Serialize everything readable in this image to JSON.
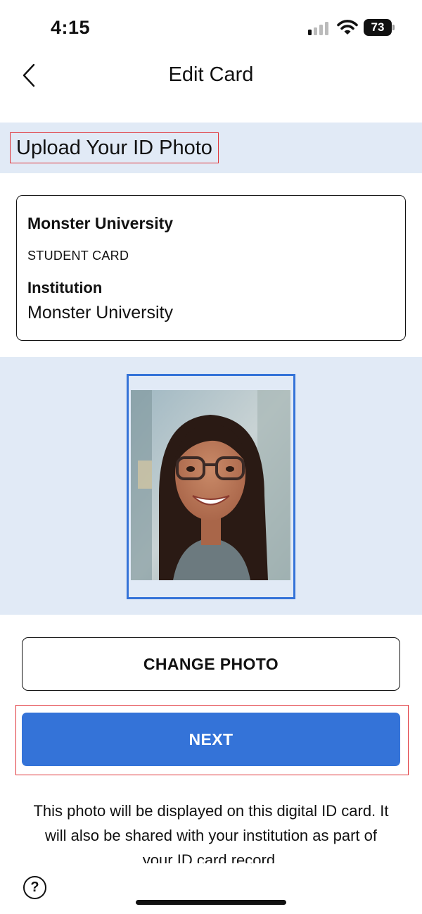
{
  "status_bar": {
    "time": "4:15",
    "battery_level": "73",
    "signal_bars_active": 1,
    "signal_bars_total": 4,
    "icons": [
      "cellular-signal-icon",
      "wifi-icon",
      "battery-icon"
    ]
  },
  "nav": {
    "back_icon": "chevron-left-icon",
    "title": "Edit Card"
  },
  "section": {
    "title": "Upload Your ID Photo"
  },
  "card": {
    "name": "Monster University",
    "type": "STUDENT CARD",
    "institution_label": "Institution",
    "institution_value": "Monster University"
  },
  "photo": {
    "description_icon": "id-photo-portrait"
  },
  "actions": {
    "change_photo_label": "CHANGE PHOTO",
    "next_label": "NEXT"
  },
  "info": {
    "text": "This photo will be displayed on this digital ID card. It will also be shared with your institution as part of your ID card record."
  },
  "help": {
    "label": "?"
  },
  "colors": {
    "accent": "#3473d8",
    "section_bg": "#e1eaf6",
    "highlight": "#e0353a"
  }
}
